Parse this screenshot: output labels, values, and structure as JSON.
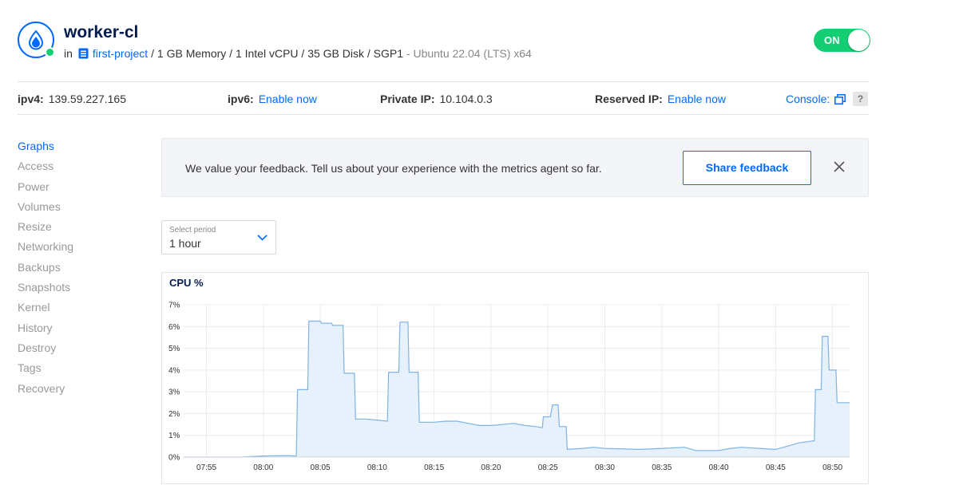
{
  "droplet": {
    "name": "worker-cl",
    "in_label": "in",
    "project": "first-project",
    "specs": "/ 1 GB Memory / 1 Intel vCPU / 35 GB Disk / SGP1",
    "os": " - Ubuntu 22.04 (LTS) x64",
    "power_toggle": "ON",
    "status_color": "#15cd72"
  },
  "network": {
    "ipv4_label": "ipv4:",
    "ipv4_value": "139.59.227.165",
    "ipv6_label": "ipv6:",
    "ipv6_link": "Enable now",
    "private_label": "Private IP:",
    "private_value": "10.104.0.3",
    "reserved_label": "Reserved IP:",
    "reserved_link": "Enable now",
    "console_label": "Console:",
    "help_label": "?"
  },
  "sidebar": {
    "items": [
      {
        "label": "Graphs",
        "active": true
      },
      {
        "label": "Access"
      },
      {
        "label": "Power"
      },
      {
        "label": "Volumes"
      },
      {
        "label": "Resize"
      },
      {
        "label": "Networking"
      },
      {
        "label": "Backups"
      },
      {
        "label": "Snapshots"
      },
      {
        "label": "Kernel"
      },
      {
        "label": "History"
      },
      {
        "label": "Destroy"
      },
      {
        "label": "Tags"
      },
      {
        "label": "Recovery"
      }
    ]
  },
  "feedback": {
    "message": "We value your feedback. Tell us about your experience with the metrics agent so far.",
    "button": "Share feedback"
  },
  "period": {
    "label": "Select period",
    "value": "1 hour"
  },
  "colors": {
    "accent": "#0069ff",
    "line": "#7fb3e6",
    "fill": "#e6f1fb"
  },
  "chart_data": {
    "type": "area",
    "title": "CPU %",
    "xlabel": "",
    "ylabel": "",
    "y_unit": "%",
    "ylim": [
      0,
      7
    ],
    "y_ticks": [
      0,
      1,
      2,
      3,
      4,
      5,
      6,
      7
    ],
    "x_tick_labels": [
      "07:55",
      "08:00",
      "08:05",
      "08:10",
      "08:15",
      "08:20",
      "08:25",
      "08:30",
      "08:35",
      "08:40",
      "08:45",
      "08:50"
    ],
    "x_range_minutes": [
      0,
      58.5
    ],
    "x_tick_minutes": [
      2,
      7,
      12,
      17,
      22,
      27,
      32,
      37,
      42,
      47,
      52,
      57
    ],
    "grid": true,
    "series": [
      {
        "points": [
          [
            0,
            0.0
          ],
          [
            3,
            0.0
          ],
          [
            5,
            0.0
          ],
          [
            7,
            0.05
          ],
          [
            9,
            0.07
          ],
          [
            9.9,
            0.05
          ],
          [
            10,
            3.1
          ],
          [
            10.9,
            3.1
          ],
          [
            11,
            6.25
          ],
          [
            12,
            6.25
          ],
          [
            12.1,
            6.15
          ],
          [
            13,
            6.15
          ],
          [
            13.1,
            6.05
          ],
          [
            14,
            6.05
          ],
          [
            14.1,
            3.85
          ],
          [
            15,
            3.85
          ],
          [
            15.1,
            1.75
          ],
          [
            16,
            1.75
          ],
          [
            17,
            1.7
          ],
          [
            17.9,
            1.65
          ],
          [
            18,
            3.9
          ],
          [
            18.9,
            3.9
          ],
          [
            19,
            6.2
          ],
          [
            19.7,
            6.2
          ],
          [
            19.8,
            3.9
          ],
          [
            20.6,
            3.9
          ],
          [
            20.7,
            1.6
          ],
          [
            22,
            1.6
          ],
          [
            23,
            1.65
          ],
          [
            24,
            1.65
          ],
          [
            25,
            1.55
          ],
          [
            26,
            1.45
          ],
          [
            27,
            1.45
          ],
          [
            28,
            1.5
          ],
          [
            29,
            1.55
          ],
          [
            30,
            1.45
          ],
          [
            31,
            1.4
          ],
          [
            31.5,
            1.35
          ],
          [
            31.6,
            1.85
          ],
          [
            32.2,
            1.85
          ],
          [
            32.4,
            2.4
          ],
          [
            32.9,
            2.4
          ],
          [
            33,
            1.4
          ],
          [
            33.6,
            1.4
          ],
          [
            33.7,
            0.35
          ],
          [
            35,
            0.4
          ],
          [
            36,
            0.45
          ],
          [
            37,
            0.4
          ],
          [
            40,
            0.35
          ],
          [
            42,
            0.4
          ],
          [
            44,
            0.45
          ],
          [
            45,
            0.3
          ],
          [
            47,
            0.3
          ],
          [
            48,
            0.4
          ],
          [
            49,
            0.45
          ],
          [
            52,
            0.35
          ],
          [
            53,
            0.5
          ],
          [
            54,
            0.65
          ],
          [
            55.4,
            0.75
          ],
          [
            55.5,
            3.1
          ],
          [
            56,
            3.1
          ],
          [
            56.1,
            5.55
          ],
          [
            56.6,
            5.55
          ],
          [
            56.7,
            4.0
          ],
          [
            57.3,
            4.0
          ],
          [
            57.4,
            2.5
          ],
          [
            58.5,
            2.5
          ]
        ]
      }
    ]
  }
}
